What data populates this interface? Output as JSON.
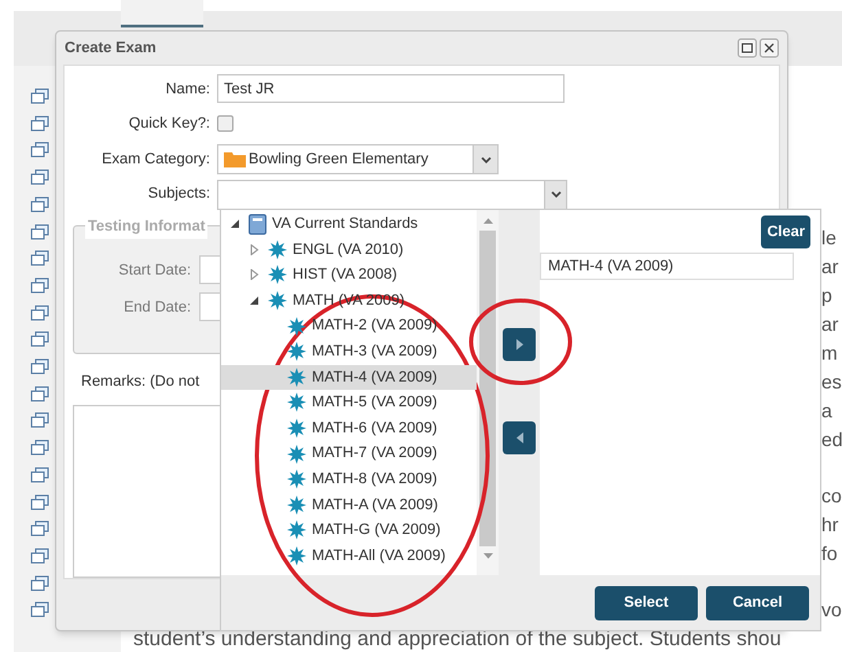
{
  "background": {
    "fragments": [
      [
        "le",
        "ar",
        "p",
        "ar",
        "m",
        "es",
        "a",
        "ed"
      ],
      [
        "co",
        "hr",
        "fo"
      ],
      [
        "vo"
      ]
    ],
    "bottom_text": "student’s understanding and appreciation of the subject. Students shou"
  },
  "dialog": {
    "title": "Create Exam",
    "fields": [
      {
        "kind": "text",
        "label": "Name:",
        "value": "Test JR"
      },
      {
        "kind": "checkbox",
        "label": "Quick Key?:",
        "checked": false
      },
      {
        "kind": "category",
        "label": "Exam Category:",
        "value": "Bowling Green Elementary"
      },
      {
        "kind": "dropdown",
        "label": "Subjects:"
      }
    ],
    "testing_info": {
      "legend": "Testing Informat",
      "rows": [
        {
          "label": "Start Date:"
        },
        {
          "label": "End Date:"
        }
      ]
    },
    "remarks_label": "Remarks: (Do not"
  },
  "picker": {
    "tree": [
      {
        "label": "VA Current Standards",
        "kind": "book",
        "expanded": true,
        "selected": false,
        "children": [
          {
            "label": "ENGL (VA 2010)",
            "kind": "star",
            "expanded": false,
            "selected": false
          },
          {
            "label": "HIST (VA 2008)",
            "kind": "star",
            "expanded": false,
            "selected": false
          },
          {
            "label": "MATH (VA 2009)",
            "kind": "star",
            "expanded": true,
            "selected": false,
            "children": [
              {
                "label": "MATH-2 (VA 2009)",
                "kind": "star",
                "selected": false
              },
              {
                "label": "MATH-3 (VA 2009)",
                "kind": "star",
                "selected": false
              },
              {
                "label": "MATH-4 (VA 2009)",
                "kind": "star",
                "selected": true
              },
              {
                "label": "MATH-5 (VA 2009)",
                "kind": "star",
                "selected": false
              },
              {
                "label": "MATH-6 (VA 2009)",
                "kind": "star",
                "selected": false
              },
              {
                "label": "MATH-7 (VA 2009)",
                "kind": "star",
                "selected": false
              },
              {
                "label": "MATH-8 (VA 2009)",
                "kind": "star",
                "selected": false
              },
              {
                "label": "MATH-A (VA 2009)",
                "kind": "star",
                "selected": false
              },
              {
                "label": "MATH-G (VA 2009)",
                "kind": "star",
                "selected": false
              },
              {
                "label": "MATH-All (VA 2009)",
                "kind": "star",
                "selected": false
              }
            ]
          }
        ]
      }
    ],
    "clear_button": "Clear",
    "chosen": [
      "MATH-4 (VA 2009)"
    ],
    "buttons": [
      "Select",
      "Cancel"
    ]
  }
}
